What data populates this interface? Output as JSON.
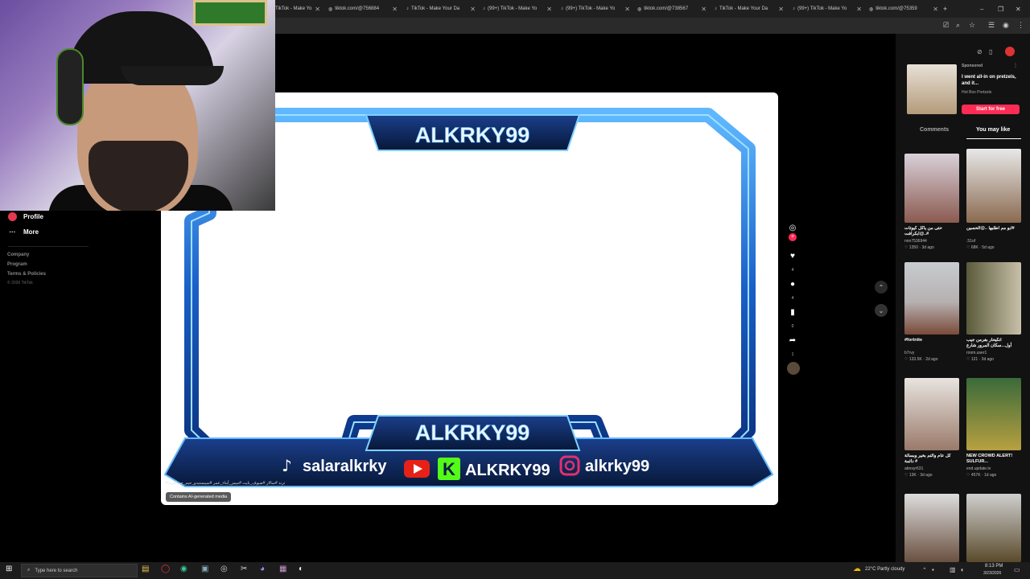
{
  "browser": {
    "tabs": [
      {
        "label": "TikTok - Make Yo",
        "icon": "tiktok-icon"
      },
      {
        "label": "tiktok.com/@756884",
        "icon": "globe-icon"
      },
      {
        "label": "TikTok - Make Your Da",
        "icon": "tiktok-icon"
      },
      {
        "label": "(99+) TikTok - Make Yo",
        "icon": "tiktok-icon"
      },
      {
        "label": "(99+) TikTok - Make Yo",
        "icon": "tiktok-icon"
      },
      {
        "label": "tiktok.com/@738567",
        "icon": "globe-icon"
      },
      {
        "label": "TikTok - Make Your Da",
        "icon": "tiktok-icon"
      },
      {
        "label": "(99+) TikTok - Make Yo",
        "icon": "tiktok-icon"
      },
      {
        "label": "tiktok.com/@75359",
        "icon": "globe-icon"
      }
    ],
    "new_tab": "+",
    "window_controls": [
      "–",
      "❐",
      "✕"
    ]
  },
  "leftnav": {
    "profile": "Profile",
    "more": "More",
    "footer": [
      "Company",
      "Program",
      "Terms & Policies",
      "© 2026 TikTok"
    ]
  },
  "video": {
    "overlay": {
      "top_name": "ALKRKY99",
      "bottom_name": "ALKRKY99",
      "tiktok_handle": "salaralkrky",
      "kick_handle": "ALKRKY99",
      "instagram_handle": "alkrky99",
      "colors": {
        "frame": "#1a6bd4",
        "glow": "#7fd0ff",
        "dark": "#0a1c44",
        "youtube": "#e62117",
        "kick": "#53fc18",
        "instagram": "#d6249f"
      }
    },
    "hashtags": "#ترند #سالار #ضيوف_نايت #ميمز_أبناء_عمر #سيبستيدو_جيم_جم #ترند",
    "ai_label": "Contains AI-generated media"
  },
  "actions": {
    "like_count": "4",
    "comment_count": "4",
    "save_count": "0",
    "share_count": "1"
  },
  "sponsored": {
    "label": "Sponsored",
    "title": "I went all-in on pretzels, and it...",
    "advertiser": "Hot Box Pretzels",
    "cta": "Start for free"
  },
  "right_tabs": {
    "comments": "Comments",
    "you_may_like": "You may like"
  },
  "cards": [
    {
      "caption": "حتى من ياكل كيوتات ..@ابكرافت#",
      "author": "nnn7536944",
      "likes": "1350",
      "age": "3d ago"
    },
    {
      "caption": "ابو مم اطلبها ..@الحسين#",
      "author": ".51of",
      "likes": "68K",
      "age": "5d ago"
    },
    {
      "caption": "#fortnite",
      "author": "b7rvy",
      "likes": "133.5K",
      "age": "2d ago"
    },
    {
      "caption": "انكيحار بفرمن جيب أول...سكان المرور شارع",
      "author": "room.user1",
      "likes": "121",
      "age": "3d ago"
    },
    {
      "caption": "كل عام والتم بخير وبسالة دائمة #",
      "author": "abnsyr631",
      "likes": "13K",
      "age": "3d ago"
    },
    {
      "caption": "NEW CROWD ALERT! SULFUR...",
      "author": "end.update.tv",
      "likes": "457K",
      "age": "1d ago"
    }
  ],
  "taskbar": {
    "search_placeholder": "Type here to search",
    "weather": "22°C  Partly cloudy",
    "time": "8:13 PM",
    "date": "3/23/2026"
  }
}
